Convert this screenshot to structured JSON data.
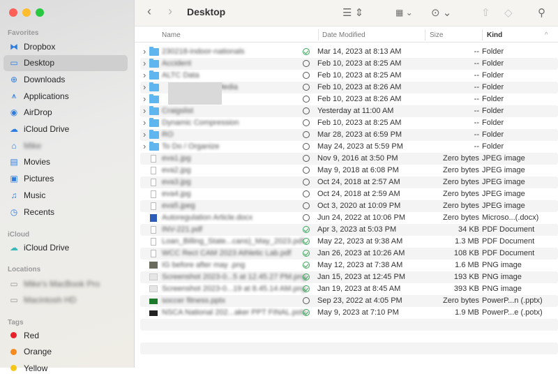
{
  "window": {
    "title": "Desktop"
  },
  "sidebar": {
    "favorites_label": "Favorites",
    "favorites": [
      {
        "label": "Dropbox",
        "icon": "dropbox-icon",
        "g": "⧓"
      },
      {
        "label": "Desktop",
        "icon": "desktop-icon",
        "g": "▭"
      },
      {
        "label": "Downloads",
        "icon": "download-icon",
        "g": "⊕"
      },
      {
        "label": "Applications",
        "icon": "applications-icon",
        "g": "⩚"
      },
      {
        "label": "AirDrop",
        "icon": "airdrop-icon",
        "g": "◉"
      },
      {
        "label": "iCloud Drive",
        "icon": "cloud-icon",
        "g": "☁"
      },
      {
        "label": "Mike",
        "icon": "home-icon",
        "g": "⌂"
      },
      {
        "label": "Movies",
        "icon": "movies-icon",
        "g": "▤"
      },
      {
        "label": "Pictures",
        "icon": "pictures-icon",
        "g": "▣"
      },
      {
        "label": "Music",
        "icon": "music-icon",
        "g": "♫"
      },
      {
        "label": "Recents",
        "icon": "clock-icon",
        "g": "◷"
      }
    ],
    "icloud_label": "iCloud",
    "icloud": [
      {
        "label": "iCloud Drive"
      }
    ],
    "locations_label": "Locations",
    "locations": [
      {
        "label": "Mike's MacBook Pro"
      },
      {
        "label": "Macintosh HD"
      }
    ],
    "tags_label": "Tags",
    "tags": [
      {
        "label": "Red",
        "color": "#e8202a"
      },
      {
        "label": "Orange",
        "color": "#f58a1f"
      },
      {
        "label": "Yellow",
        "color": "#f5c518"
      }
    ]
  },
  "columns": {
    "name": "Name",
    "date": "Date Modified",
    "size": "Size",
    "kind": "Kind"
  },
  "files": [
    {
      "name": "230218-indoor-nationals",
      "type": "folder",
      "status": "ok",
      "date": "Mar 14, 2023 at 8:13 AM",
      "size": "--",
      "kind": "Folder"
    },
    {
      "name": "Accident",
      "type": "folder",
      "status": "cl",
      "date": "Feb 10, 2023 at 8:25 AM",
      "size": "--",
      "kind": "Folder"
    },
    {
      "name": "ALTC Data",
      "type": "folder",
      "status": "cl",
      "date": "Feb 10, 2023 at 8:25 AM",
      "size": "--",
      "kind": "Folder"
    },
    {
      "name": "Media",
      "type": "folder",
      "status": "cl",
      "date": "Feb 10, 2023 at 8:26 AM",
      "size": "--",
      "kind": "Folder"
    },
    {
      "name": "",
      "type": "folder",
      "status": "cl",
      "date": "Feb 10, 2023 at 8:26 AM",
      "size": "--",
      "kind": "Folder"
    },
    {
      "name": "Craigslist",
      "type": "folder",
      "status": "cl",
      "date": "Yesterday at 11:00 AM",
      "size": "--",
      "kind": "Folder"
    },
    {
      "name": "Dynamic Compression",
      "type": "folder",
      "status": "cl",
      "date": "Feb 10, 2023 at 8:25 AM",
      "size": "--",
      "kind": "Folder"
    },
    {
      "name": "RO",
      "type": "folder",
      "status": "cl",
      "date": "Mar 28, 2023 at 6:59 PM",
      "size": "--",
      "kind": "Folder"
    },
    {
      "name": "To Do / Organize",
      "type": "folder",
      "status": "cl",
      "date": "May 24, 2023 at 5:59 PM",
      "size": "--",
      "kind": "Folder"
    },
    {
      "name": "eva1.jpg",
      "type": "doc",
      "status": "cl",
      "date": "Nov 9, 2016 at 3:50 PM",
      "size": "Zero bytes",
      "kind": "JPEG image"
    },
    {
      "name": "eva2.jpg",
      "type": "doc",
      "status": "cl",
      "date": "May 9, 2018 at 6:08 PM",
      "size": "Zero bytes",
      "kind": "JPEG image"
    },
    {
      "name": "eva3.jpg",
      "type": "doc",
      "status": "cl",
      "date": "Oct 24, 2018 at 2:57 AM",
      "size": "Zero bytes",
      "kind": "JPEG image"
    },
    {
      "name": "eva4.jpg",
      "type": "doc",
      "status": "cl",
      "date": "Oct 24, 2018 at 2:59 AM",
      "size": "Zero bytes",
      "kind": "JPEG image"
    },
    {
      "name": "eva5.jpeg",
      "type": "doc",
      "status": "cl",
      "date": "Oct 3, 2020 at 10:09 PM",
      "size": "Zero bytes",
      "kind": "JPEG image"
    },
    {
      "name": "Autoregulation Article.docx",
      "type": "word",
      "status": "cl",
      "date": "Jun 24, 2022 at 10:06 PM",
      "size": "Zero bytes",
      "kind": "Microso...(.docx)"
    },
    {
      "name": "INV-221.pdf",
      "type": "doc",
      "status": "ok",
      "date": "Apr 3, 2023 at 5:03 PM",
      "size": "34 KB",
      "kind": "PDF Document"
    },
    {
      "name": "Loan_Billing_State...cans)_May_2023.pdf",
      "type": "doc",
      "status": "ok",
      "date": "May 22, 2023 at 9:38 AM",
      "size": "1.3 MB",
      "kind": "PDF Document"
    },
    {
      "name": "WCC Rect CAM 2023 Athletic Lab.pdf",
      "type": "doc",
      "status": "ok",
      "date": "Jan 26, 2023 at 10:26 AM",
      "size": "108 KB",
      "kind": "PDF Document"
    },
    {
      "name": "IG before after may .png",
      "type": "img",
      "status": "ok",
      "date": "May 12, 2023 at 7:38 AM",
      "size": "1.6 MB",
      "kind": "PNG image"
    },
    {
      "name": "Screenshot 2023-0...5 at 12.45.27 PM.png",
      "type": "shot",
      "status": "ok",
      "date": "Jan 15, 2023 at 12:45 PM",
      "size": "193 KB",
      "kind": "PNG image"
    },
    {
      "name": "Screenshot 2023-0...19 at 8.45.14 AM.png",
      "type": "shot",
      "status": "ok",
      "date": "Jan 19, 2023 at 8:45 AM",
      "size": "393 KB",
      "kind": "PNG image"
    },
    {
      "name": "soccer fitness.pptx",
      "type": "ppt",
      "status": "cl",
      "date": "Sep 23, 2022 at 4:05 PM",
      "size": "Zero bytes",
      "kind": "PowerP...n (.pptx)"
    },
    {
      "name": "NSCA National 202...aker PPT FINAL.potx",
      "type": "ppt2",
      "status": "ok",
      "date": "May 9, 2023 at 7:10 PM",
      "size": "1.9 MB",
      "kind": "PowerP...e (.potx)"
    }
  ]
}
